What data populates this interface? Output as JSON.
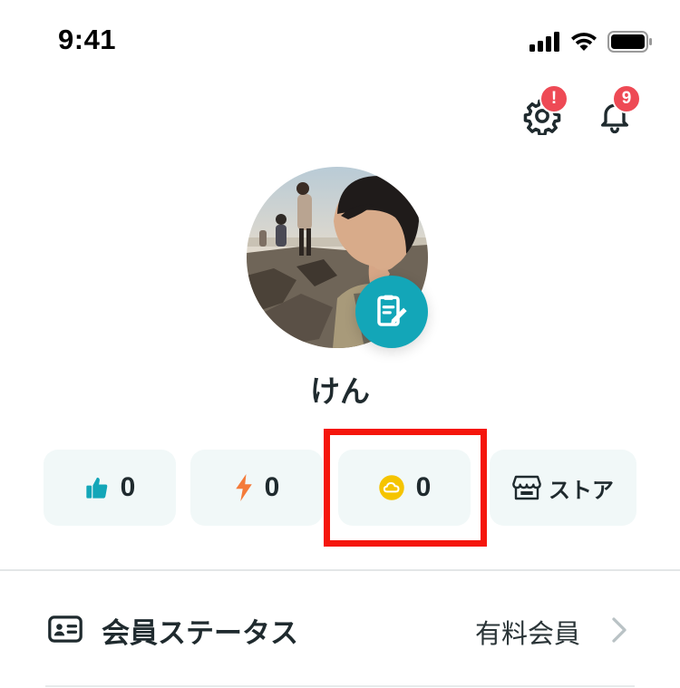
{
  "status_bar": {
    "time": "9:41"
  },
  "header": {
    "settings_badge": "!",
    "notifications_badge": "9"
  },
  "profile": {
    "username": "けん"
  },
  "stats": {
    "likes": "0",
    "energy": "0",
    "coins": "0",
    "store_label": "ストア"
  },
  "membership": {
    "label": "会員ステータス",
    "value": "有料会員"
  },
  "colors": {
    "accent_teal": "#13a6b8",
    "badge_red": "#ee4a55",
    "highlight_red": "#f5160c",
    "chip_bg": "#f1f8f8",
    "coin_yellow": "#f5c400",
    "energy_orange": "#f47b3a"
  },
  "icons": [
    "cellular-icon",
    "wifi-icon",
    "battery-icon",
    "gear-icon",
    "bell-icon",
    "edit-profile-icon",
    "thumbs-up-icon",
    "lightning-icon",
    "coin-icon",
    "store-icon",
    "member-card-icon",
    "chevron-right-icon"
  ]
}
